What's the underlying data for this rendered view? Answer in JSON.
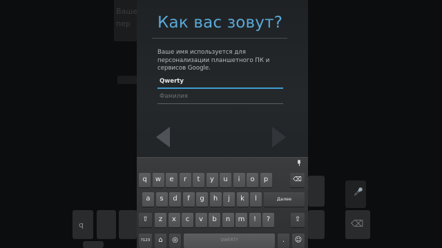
{
  "setup": {
    "title": "Как вас зовут?",
    "description": "Ваше имя используется для персонализации планшетного ПК и сервисов Google.",
    "first_name_value": "Qwerty",
    "last_name_placeholder": "Фамилия"
  },
  "keyboard": {
    "row1": [
      "q",
      "w",
      "e",
      "r",
      "t",
      "y",
      "u",
      "i",
      "o",
      "p"
    ],
    "row2": [
      "a",
      "s",
      "d",
      "f",
      "g",
      "h",
      "j",
      "k",
      "l"
    ],
    "row3": [
      "z",
      "x",
      "c",
      "v",
      "b",
      "n",
      "m",
      "!",
      "?"
    ],
    "enter_label": "Далее",
    "symbols_label": "?123",
    "space_label": "QWERTY",
    "period_label": "."
  },
  "colors": {
    "accent": "#3f9fd4",
    "title": "#5aa9d8",
    "key": "#555759"
  },
  "icons": [
    "mic-icon",
    "backspace-icon",
    "shift-icon",
    "enter-icon",
    "language-icon",
    "back-arrow-icon",
    "next-arrow-icon"
  ]
}
